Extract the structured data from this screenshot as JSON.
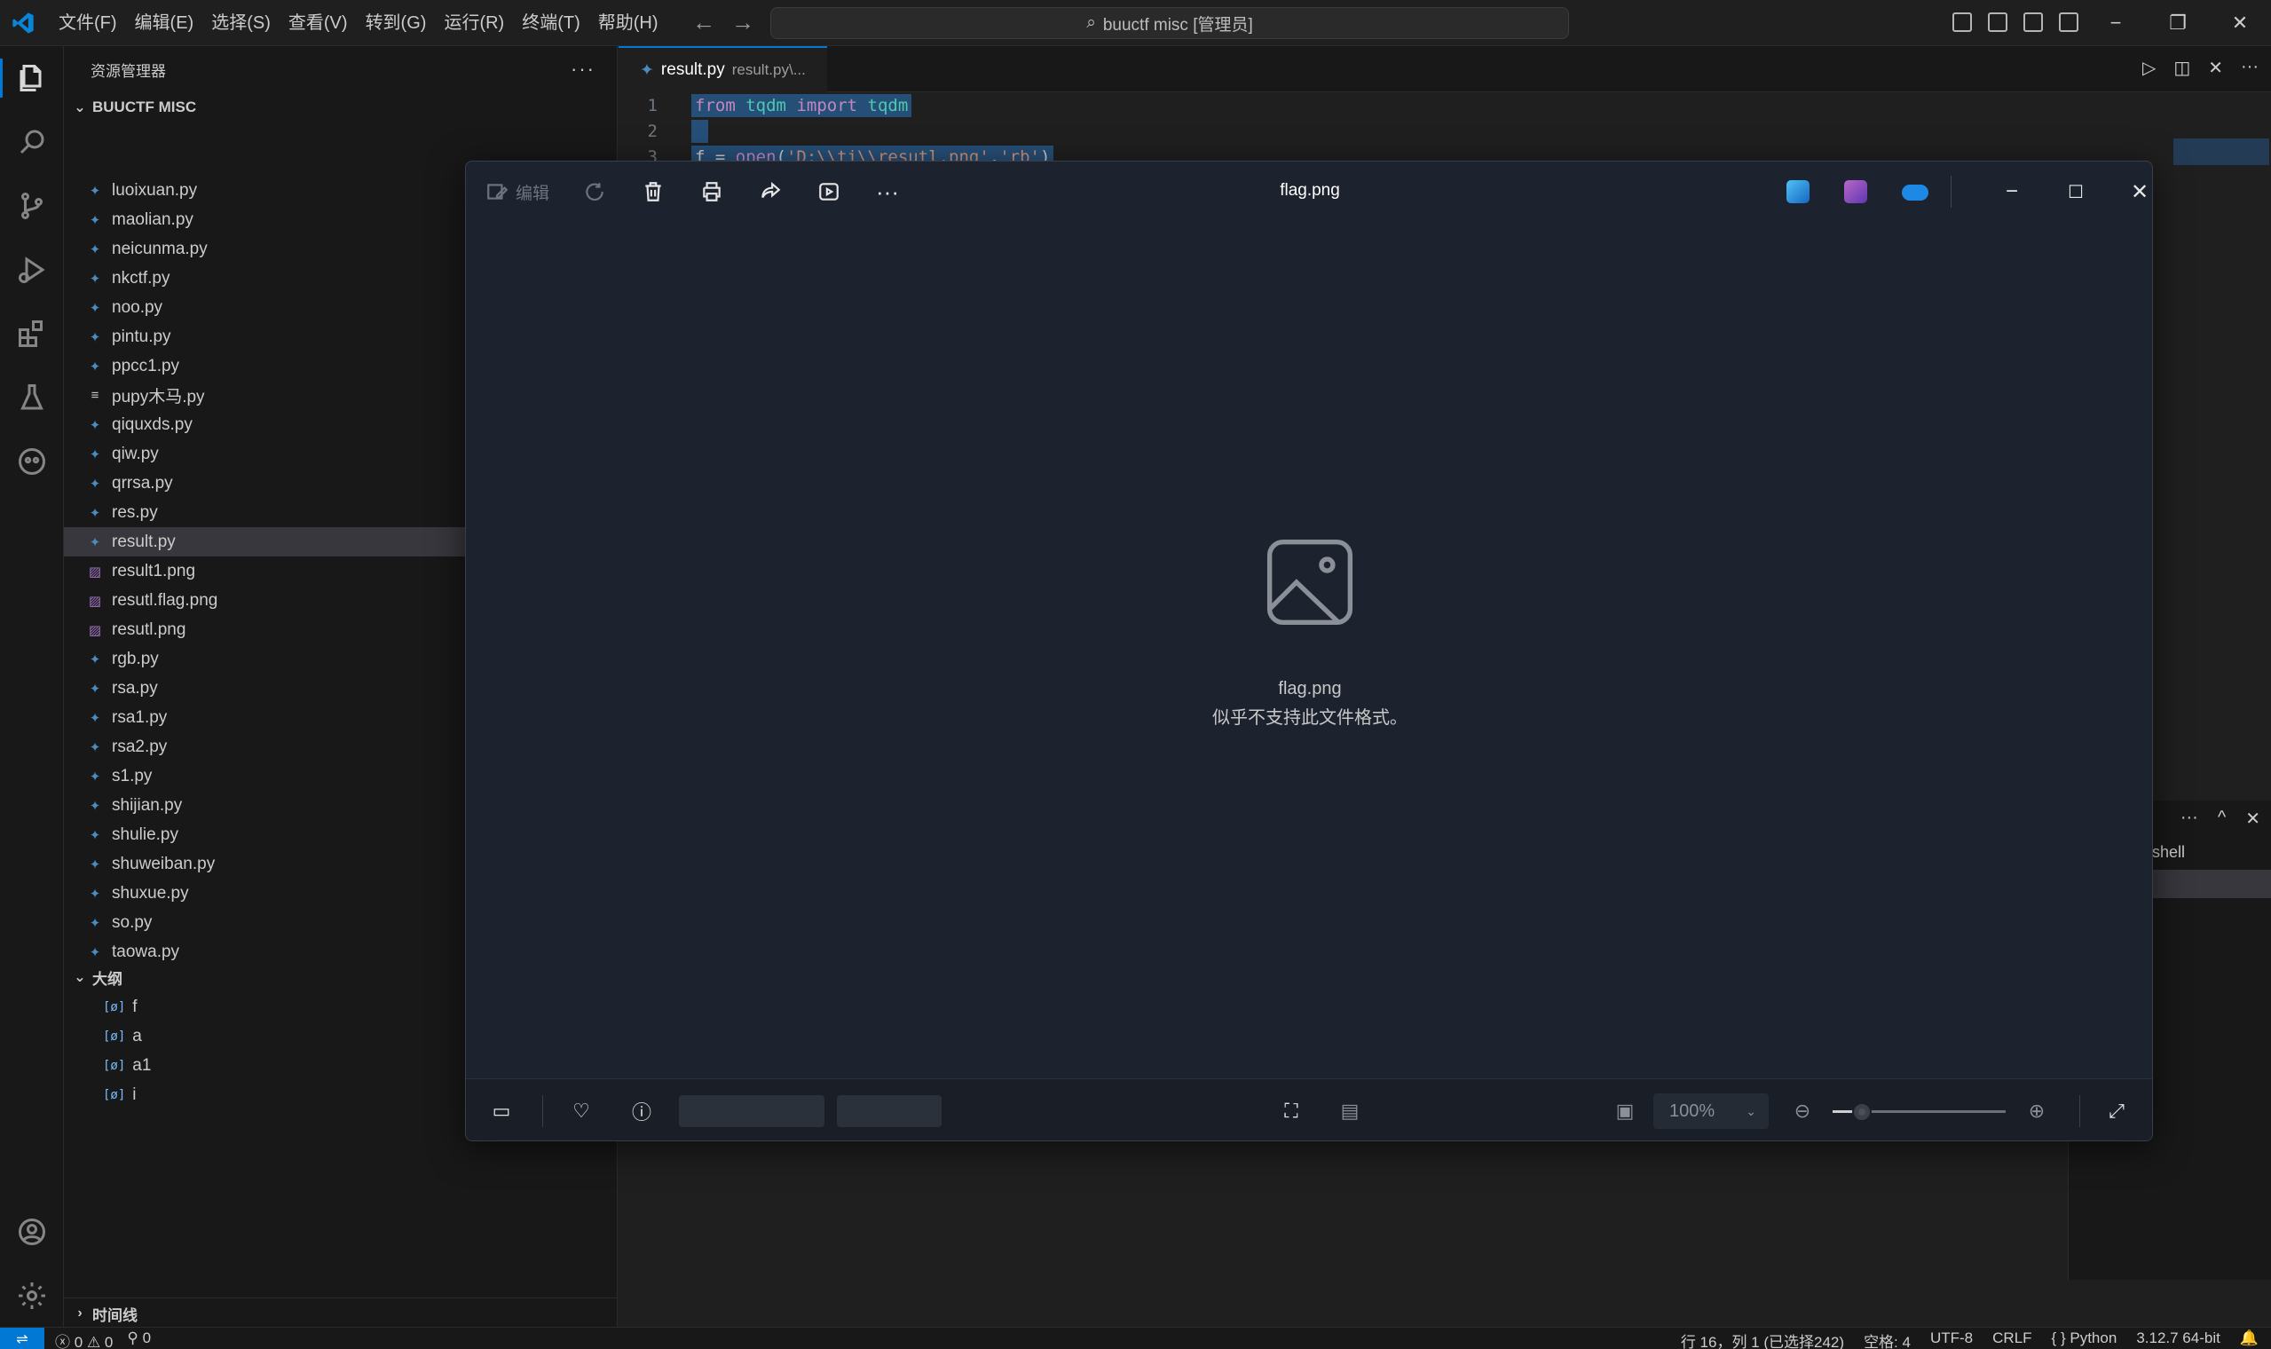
{
  "titlebar": {
    "menus": [
      "文件(F)",
      "编辑(E)",
      "选择(S)",
      "查看(V)",
      "转到(G)",
      "运行(R)",
      "终端(T)",
      "帮助(H)"
    ],
    "search_text": "buuctf misc [管理员]",
    "win_min": "−",
    "win_restore": "❐",
    "win_close": "✕"
  },
  "sidebar": {
    "header": "资源管理器",
    "more": "···",
    "folder": "BUUCTF MISC",
    "files": [
      {
        "name": "luoixuan.py",
        "type": "py"
      },
      {
        "name": "maolian.py",
        "type": "py"
      },
      {
        "name": "neicunma.py",
        "type": "py"
      },
      {
        "name": "nkctf.py",
        "type": "py"
      },
      {
        "name": "noo.py",
        "type": "py"
      },
      {
        "name": "pintu.py",
        "type": "py"
      },
      {
        "name": "ppcc1.py",
        "type": "py"
      },
      {
        "name": "pupy木马.py",
        "type": "txt"
      },
      {
        "name": "qiquxds.py",
        "type": "py"
      },
      {
        "name": "qiw.py",
        "type": "py"
      },
      {
        "name": "qrrsa.py",
        "type": "py"
      },
      {
        "name": "res.py",
        "type": "py"
      },
      {
        "name": "result.py",
        "type": "py",
        "selected": true
      },
      {
        "name": "result1.png",
        "type": "png"
      },
      {
        "name": "resutl.flag.png",
        "type": "png"
      },
      {
        "name": "resutl.png",
        "type": "png"
      },
      {
        "name": "rgb.py",
        "type": "py"
      },
      {
        "name": "rsa.py",
        "type": "py"
      },
      {
        "name": "rsa1.py",
        "type": "py"
      },
      {
        "name": "rsa2.py",
        "type": "py"
      },
      {
        "name": "s1.py",
        "type": "py"
      },
      {
        "name": "shijian.py",
        "type": "py"
      },
      {
        "name": "shulie.py",
        "type": "py"
      },
      {
        "name": "shuweiban.py",
        "type": "py"
      },
      {
        "name": "shuxue.py",
        "type": "py"
      },
      {
        "name": "so.py",
        "type": "py"
      },
      {
        "name": "taowa.py",
        "type": "py"
      }
    ],
    "outline_title": "大纲",
    "outline_items": [
      "f",
      "a",
      "a1",
      "i"
    ],
    "timeline_title": "时间线"
  },
  "editor": {
    "tab_name": "result.py",
    "tab_desc": "result.py\\...",
    "lines": [
      {
        "num": "1"
      },
      {
        "num": "2"
      },
      {
        "num": "3"
      }
    ]
  },
  "panel": {
    "shell_label": "shell",
    "more": "···",
    "collapse": "^",
    "close": "✕"
  },
  "statusbar": {
    "errors": "0",
    "warnings": "0",
    "ports": "0",
    "position": "行 16，列 1 (已选择242)",
    "spaces": "空格: 4",
    "encoding": "UTF-8",
    "eol": "CRLF",
    "language": "Python",
    "interpreter": "3.12.7 64-bit"
  },
  "viewer": {
    "edit_label": "编辑",
    "file_name": "flag.png",
    "placeholder_name": "flag.png",
    "placeholder_message": "似乎不支持此文件格式。",
    "zoom": "100%",
    "win_min": "−",
    "win_max": "☐",
    "win_close": "✕"
  }
}
